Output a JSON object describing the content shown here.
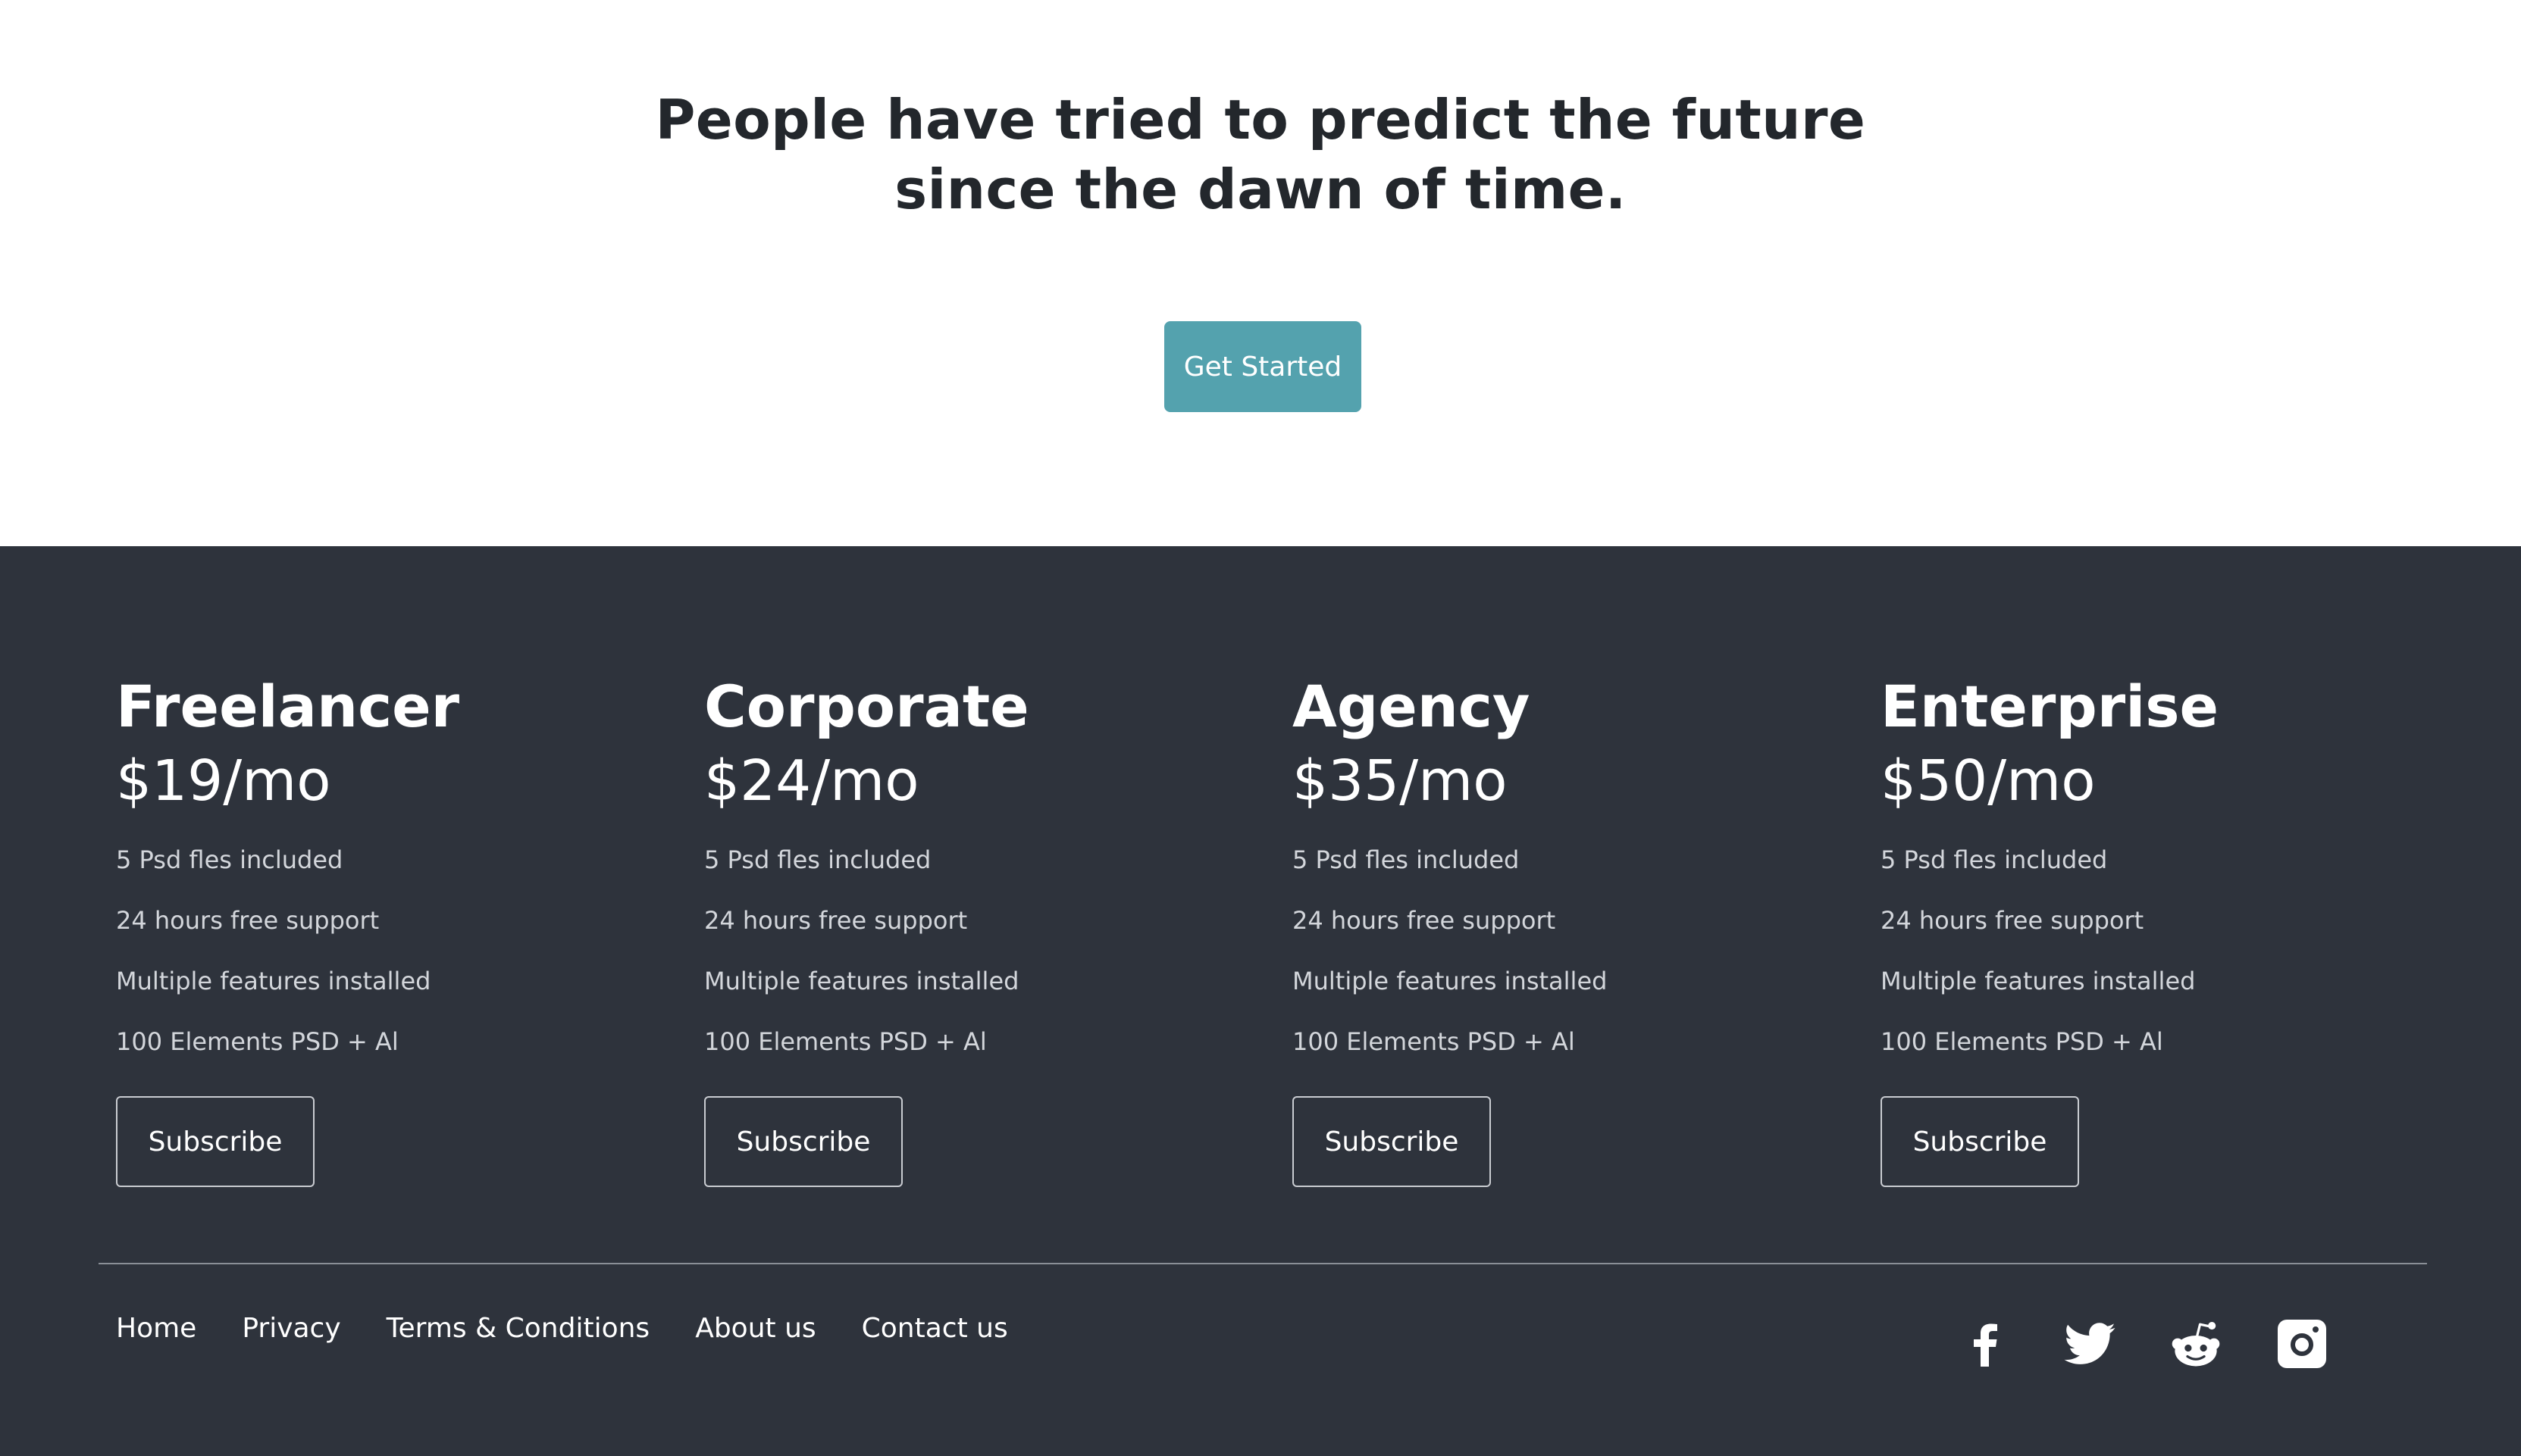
{
  "hero": {
    "title_line1": "People have tried to predict the future",
    "title_line2": "since the dawn of time.",
    "cta_label": "Get Started"
  },
  "colors": {
    "accent": "#54a2ae",
    "dark_bg": "#2e333c",
    "heading": "#23272c"
  },
  "plans": [
    {
      "name": "Freelancer",
      "price": "$19/mo",
      "features": [
        "5 Psd fles included",
        "24 hours free support",
        "Multiple features installed",
        "100 Elements PSD + Al"
      ],
      "button": "Subscribe"
    },
    {
      "name": "Corporate",
      "price": "$24/mo",
      "features": [
        "5 Psd fles included",
        "24 hours free support",
        "Multiple features installed",
        "100 Elements PSD + Al"
      ],
      "button": "Subscribe"
    },
    {
      "name": "Agency",
      "price": "$35/mo",
      "features": [
        "5 Psd fles included",
        "24 hours free support",
        "Multiple features installed",
        "100 Elements PSD + Al"
      ],
      "button": "Subscribe"
    },
    {
      "name": "Enterprise",
      "price": "$50/mo",
      "features": [
        "5 Psd fles included",
        "24 hours free support",
        "Multiple features installed",
        "100 Elements PSD + Al"
      ],
      "button": "Subscribe"
    }
  ],
  "footer": {
    "links": [
      "Home",
      "Privacy",
      "Terms & Conditions",
      "About us",
      "Contact us"
    ],
    "social_icons": [
      "facebook-icon",
      "twitter-icon",
      "reddit-icon",
      "instagram-icon"
    ]
  }
}
